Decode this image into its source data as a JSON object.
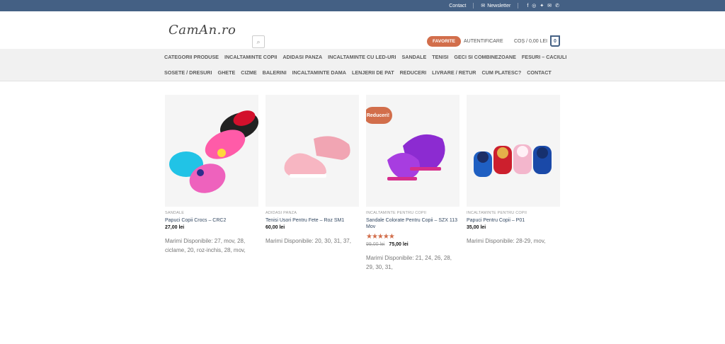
{
  "topbar": {
    "contact": "Contact",
    "newsletter": "Newsletter",
    "social": [
      "facebook-icon",
      "instagram-icon",
      "twitter-icon",
      "email-icon",
      "phone-icon"
    ]
  },
  "header": {
    "logo": "CamAn.ro",
    "favorites": "FAVORITE",
    "login": "AUTENTIFICARE",
    "cart": "COȘ / 0,00 LEI",
    "cart_count": "0"
  },
  "nav": {
    "row1": [
      "CATEGORII PRODUSE",
      "INCALTAMINTE COPII",
      "ADIDASI PANZA",
      "INCALTAMINTE CU LED-URI",
      "SANDALE",
      "TENISI",
      "GECI SI COMBINEZOANE",
      "FESURI – CACIULI"
    ],
    "row2": [
      "SOSETE / DRESURI",
      "GHETE",
      "CIZME",
      "BALERINI",
      "INCALTAMINTE DAMA",
      "LENJERII DE PAT",
      "REDUCERI",
      "LIVRARE / RETUR",
      "CUM PLATESC?",
      "CONTACT"
    ]
  },
  "products": [
    {
      "category": "SANDALE",
      "name": "Papuci Copii Crocs – CRC2",
      "old_price": "",
      "price": "27,00 lei",
      "sizes": "Marimi Disponibile: 27, mov, 28, ciclame, 20, roz-inchis, 28, mov,",
      "badge": "",
      "rating": ""
    },
    {
      "category": "ADIDASI PANZA",
      "name": "Tenisi Usori Pentru Fete – Roz SM1",
      "old_price": "",
      "price": "60,00 lei",
      "sizes": "Marimi Disponibile: 20, 30, 31, 37,",
      "badge": "",
      "rating": ""
    },
    {
      "category": "INCALTAMINTE PENTRU COPII",
      "name": "Sandale Colorate Pentru Copii – SZX 113 Mov",
      "old_price": "99,00 lei",
      "price": "75,00 lei",
      "sizes": "Marimi Disponibile: 21, 24, 26, 28, 29, 30, 31,",
      "badge": "Reduceri!",
      "rating": "★★★★★"
    },
    {
      "category": "INCALTAMINTE PENTRU COPII",
      "name": "Papuci Pentru Copii – P01",
      "old_price": "",
      "price": "35,00 lei",
      "sizes": "Marimi Disponibile: 28-29, mov,",
      "badge": "",
      "rating": ""
    }
  ],
  "colors": {
    "topbar": "#446084",
    "accent": "#d26e4b"
  }
}
